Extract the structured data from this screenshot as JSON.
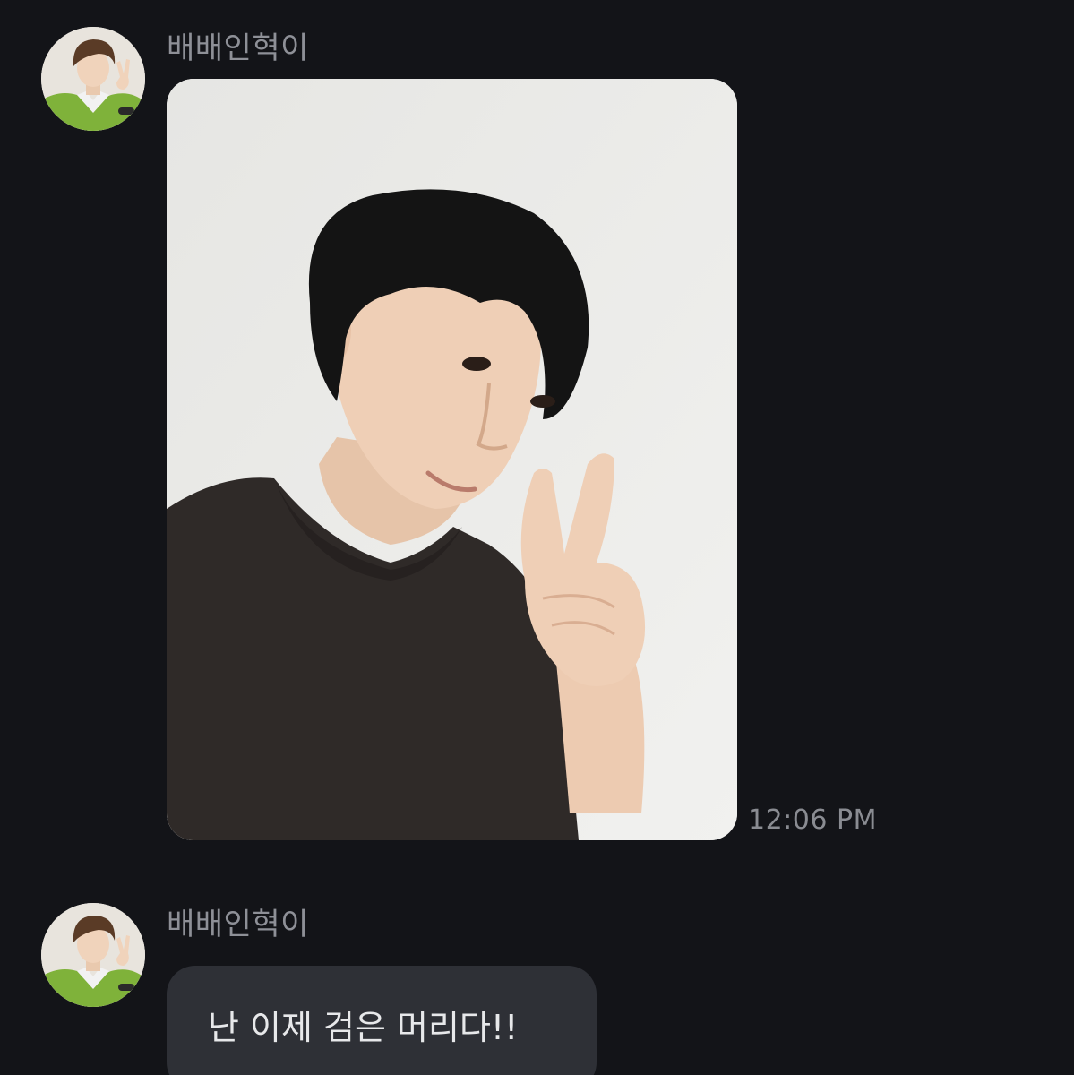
{
  "messages": [
    {
      "sender": "배배인혁이",
      "avatar": "profile-photo",
      "type": "photo",
      "photo": "selfie-peace-sign-photo",
      "time": "12:06 PM"
    },
    {
      "sender": "배배인혁이",
      "avatar": "profile-photo",
      "type": "text",
      "text": "난 이제 검은 머리다!!"
    }
  ],
  "colors": {
    "background": "#131418",
    "sender_name": "#8e9097",
    "timestamp": "#8a8c92",
    "bubble": "#2e3036",
    "bubble_text": "#e7e8ea"
  }
}
